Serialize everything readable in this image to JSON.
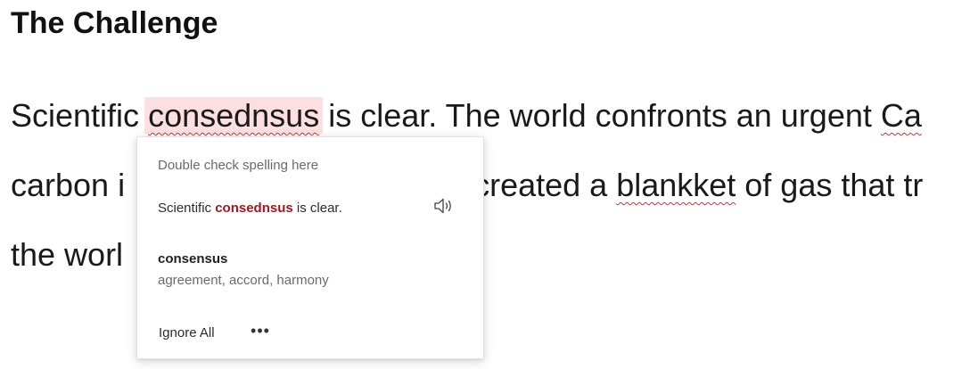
{
  "document": {
    "heading": "The Challenge",
    "line1": {
      "before": "Scientific ",
      "flagged": "consednsus",
      "after": " is clear. The world confronts an urgent ",
      "cut_flagged": "Ca"
    },
    "line2": {
      "start": "carbon i",
      "middle": "created a ",
      "flagged": "blankket",
      "after": " of gas that tr"
    },
    "line3": {
      "start": "the worl"
    }
  },
  "spelling_popup": {
    "header": "Double check spelling here",
    "context_before": "Scientific ",
    "context_word": "consednsus",
    "context_after": " is clear.",
    "speaker_icon": "speaker-icon",
    "suggestion": {
      "word": "consensus",
      "synonyms": "agreement, accord, harmony"
    },
    "ignore_all_label": "Ignore All",
    "more_label": "•••"
  },
  "colors": {
    "misspelling_underline": "#d32f2f",
    "flagged_highlight": "#fbdfe1",
    "context_word": "#a31621"
  }
}
